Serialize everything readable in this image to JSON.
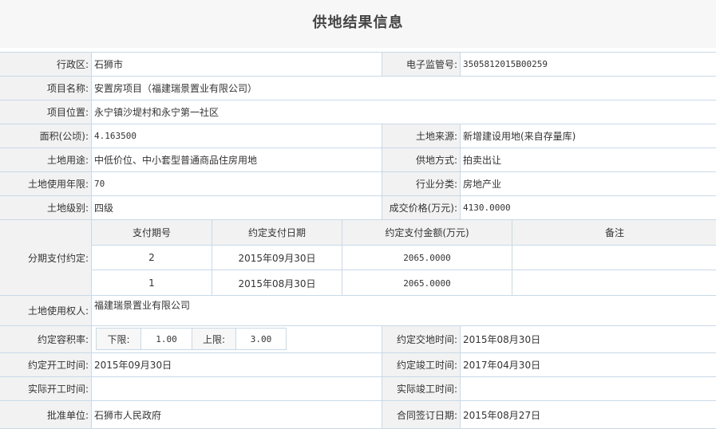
{
  "title": "供地结果信息",
  "rows": {
    "district": {
      "label": "行政区:",
      "value": "石狮市"
    },
    "supervision_no": {
      "label": "电子监管号:",
      "value": "3505812015B00259"
    },
    "project_name": {
      "label": "项目名称:",
      "value": "安置房项目（福建瑞景置业有限公司）"
    },
    "project_location": {
      "label": "项目位置:",
      "value": "永宁镇沙堤村和永宁第一社区"
    },
    "area": {
      "label": "面积(公顷):",
      "value": "4.163500"
    },
    "land_source": {
      "label": "土地来源:",
      "value": "新增建设用地(来自存量库)"
    },
    "land_use": {
      "label": "土地用途:",
      "value": "中低价位、中小套型普通商品住房用地"
    },
    "supply_method": {
      "label": "供地方式:",
      "value": "拍卖出让"
    },
    "use_years": {
      "label": "土地使用年限:",
      "value": "70"
    },
    "industry": {
      "label": "行业分类:",
      "value": "房地产业"
    },
    "land_level": {
      "label": "土地级别:",
      "value": "四级"
    },
    "price": {
      "label": "成交价格(万元):",
      "value": "4130.0000"
    },
    "installment": {
      "label": "分期支付约定:",
      "headers": [
        "支付期号",
        "约定支付日期",
        "约定支付金额(万元)",
        "备注"
      ],
      "items": [
        {
          "period": "2",
          "date": "2015年09月30日",
          "amount": "2065.0000",
          "note": ""
        },
        {
          "period": "1",
          "date": "2015年08月30日",
          "amount": "2065.0000",
          "note": ""
        }
      ]
    },
    "land_user": {
      "label": "土地使用权人:",
      "value": "福建瑞景置业有限公司"
    },
    "far": {
      "label": "约定容积率:",
      "lower_label": "下限:",
      "lower": "1.00",
      "upper_label": "上限:",
      "upper": "3.00"
    },
    "delivery_time": {
      "label": "约定交地时间:",
      "value": "2015年08月30日"
    },
    "start_time": {
      "label": "约定开工时间:",
      "value": "2015年09月30日"
    },
    "completion_time": {
      "label": "约定竣工时间:",
      "value": "2017年04月30日"
    },
    "actual_start": {
      "label": "实际开工时间:",
      "value": ""
    },
    "actual_completion": {
      "label": "实际竣工时间:",
      "value": ""
    },
    "approval_unit": {
      "label": "批准单位:",
      "value": "石狮市人民政府"
    },
    "contract_date": {
      "label": "合同签订日期:",
      "value": "2015年08月27日"
    }
  }
}
